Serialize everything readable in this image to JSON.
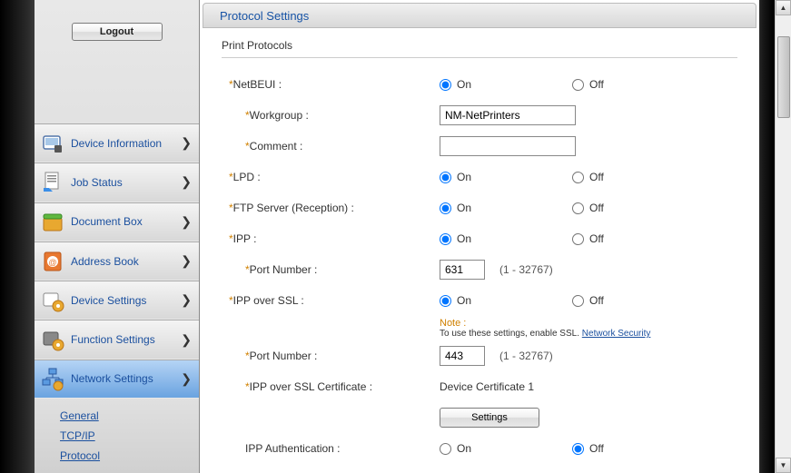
{
  "sidebar": {
    "logout": "Logout",
    "items": [
      {
        "label": "Device Information"
      },
      {
        "label": "Job Status"
      },
      {
        "label": "Document Box"
      },
      {
        "label": "Address Book"
      },
      {
        "label": "Device Settings"
      },
      {
        "label": "Function Settings"
      },
      {
        "label": "Network Settings"
      }
    ],
    "sub": [
      {
        "label": "General"
      },
      {
        "label": "TCP/IP"
      },
      {
        "label": "Protocol"
      }
    ]
  },
  "panel": {
    "title": "Protocol Settings",
    "section": "Print Protocols",
    "labels": {
      "netbeui": "NetBEUI :",
      "workgroup": "Workgroup :",
      "comment": "Comment :",
      "lpd": "LPD :",
      "ftp": "FTP Server (Reception) :",
      "ipp": "IPP :",
      "port": "Port Number :",
      "ipp_ssl": "IPP over SSL :",
      "ipp_ssl_cert": "IPP over SSL Certificate :",
      "ipp_auth": "IPP Authentication :"
    },
    "values": {
      "workgroup": "NM-NetPrinters",
      "comment": "",
      "port_ipp": "631",
      "port_ipp_ssl": "443",
      "range": "(1 - 32767)",
      "cert": "Device Certificate 1"
    },
    "radio": {
      "on": "On",
      "off": "Off"
    },
    "note": {
      "label": "Note :",
      "text": "To use these settings, enable SSL.  ",
      "link": "Network Security"
    },
    "settings_btn": "Settings"
  }
}
